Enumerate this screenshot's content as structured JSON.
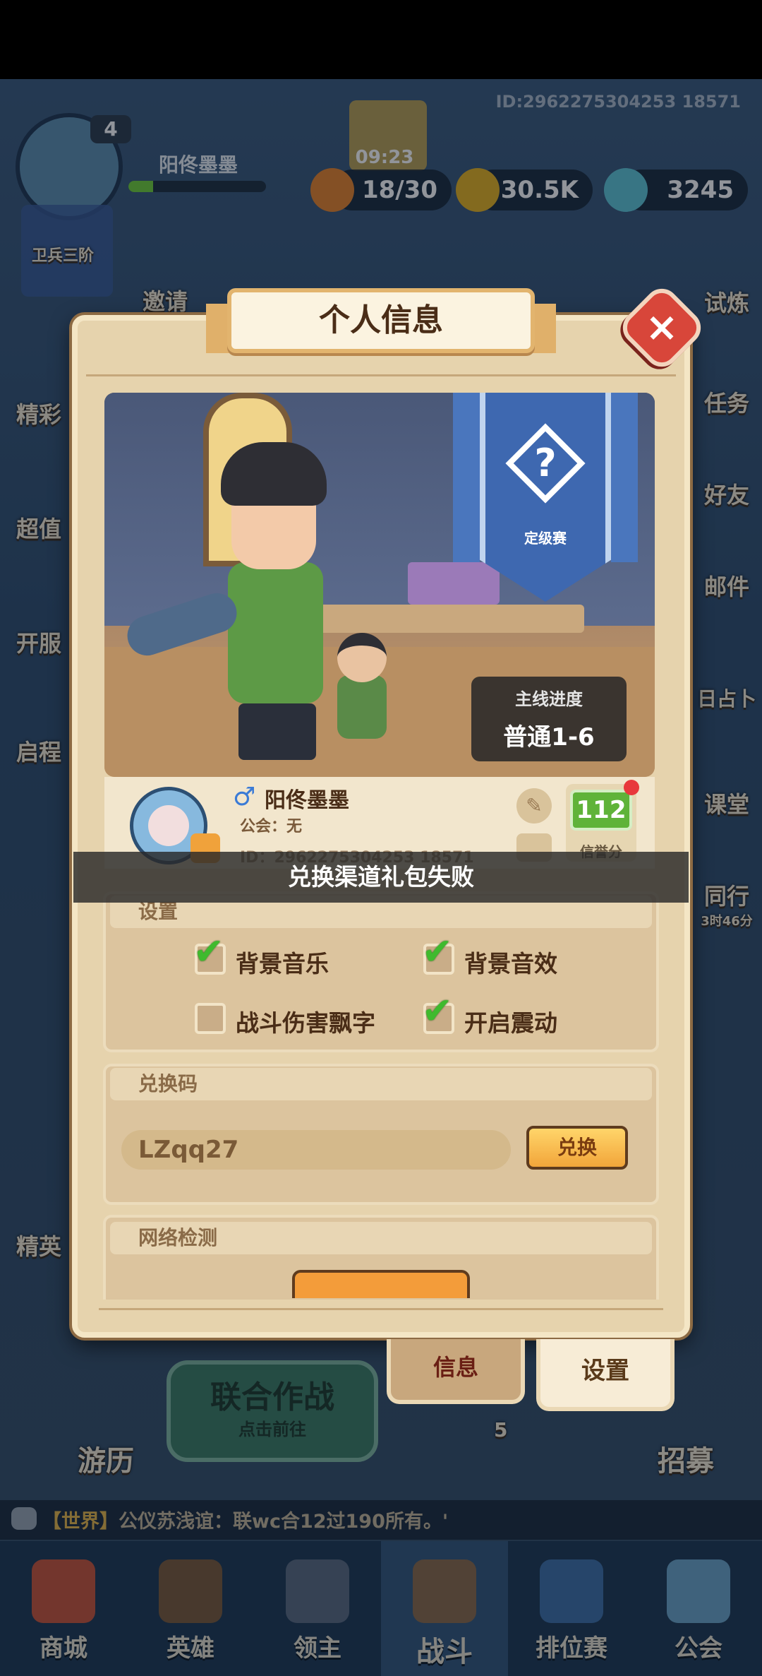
{
  "top": {
    "uid": "ID:2962275304253 18571",
    "level": "4",
    "player_name": "阳佟墨墨",
    "rank_tag": "卫兵三阶",
    "timer": "09:23",
    "stamina": "18/30",
    "gold": "30.5K",
    "gems": "3245",
    "left_menu": [
      "邀请",
      "精彩",
      "超值",
      "开服",
      "启程",
      "精英"
    ],
    "right_menu": [
      "试炼",
      "任务",
      "好友",
      "邮件",
      "日占卜",
      "课堂",
      "同行",
      "3时46分"
    ]
  },
  "dialog": {
    "title": "个人信息",
    "close_icon": "×",
    "rank_banner_label": "定级赛",
    "rank_banner_symbol": "?",
    "main_progress_title": "主线进度",
    "main_progress_value": "普通1-6",
    "profile": {
      "gender_symbol": "♂",
      "name": "阳佟墨墨",
      "guild": "公会：无",
      "id": "ID：2962275304253 18571",
      "credit_value": "112",
      "credit_label": "信誉分"
    },
    "toast": "兑换渠道礼包失败",
    "settings": {
      "header": "设置",
      "options": [
        {
          "label": "背景音乐",
          "checked": true
        },
        {
          "label": "背景音效",
          "checked": true
        },
        {
          "label": "战斗伤害飘字",
          "checked": false
        },
        {
          "label": "开启震动",
          "checked": true
        }
      ],
      "check_glyph": "✔"
    },
    "redeem": {
      "header": "兑换码",
      "code": "LZqq27",
      "button": "兑换"
    },
    "network": {
      "header": "网络检测"
    },
    "tabs": {
      "info": "信息",
      "settings": "设置"
    }
  },
  "background": {
    "coop_title": "联合作战",
    "coop_sub": "点击前往",
    "travel": "游历",
    "recruit": "招募",
    "energy_cost": "5"
  },
  "chat": {
    "channel": "【世界】",
    "message": "公仪苏浅谊：联wc合12过190所有。'"
  },
  "nav": {
    "items": [
      "商城",
      "英雄",
      "领主",
      "战斗",
      "排位赛",
      "公会"
    ],
    "active_index": 3
  },
  "colors": {
    "dialog_bg": "#e6d3ad",
    "accent_green": "#5fb339",
    "close_red": "#d8463a",
    "banner_blue": "#3e68b0"
  }
}
